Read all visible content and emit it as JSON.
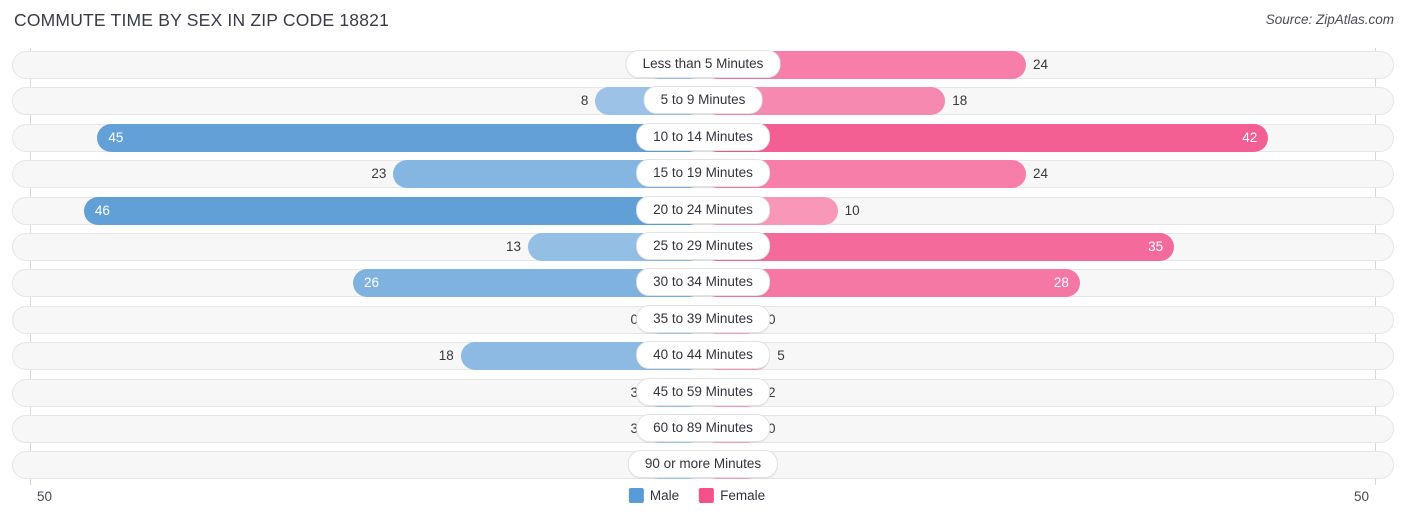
{
  "header": {
    "title": "COMMUTE TIME BY SEX IN ZIP CODE 18821",
    "source": "Source: ZipAtlas.com"
  },
  "axis": {
    "left_max_label": "50",
    "right_max_label": "50"
  },
  "legend": {
    "items": [
      {
        "label": "Male",
        "color": "#5b9bd5"
      },
      {
        "label": "Female",
        "color": "#f2518a"
      }
    ]
  },
  "colors": {
    "male_high": "#5b9bd5",
    "male_low": "#a8cbeb",
    "female_high": "#f2518a",
    "female_low": "#f9a8c4",
    "track_bg": "#f7f7f7",
    "track_border": "#e6e6e6",
    "gridline": "#d8d8d8"
  },
  "chart_data": {
    "type": "bar",
    "title": "COMMUTE TIME BY SEX IN ZIP CODE 18821",
    "subtitle": "Source: ZipAtlas.com",
    "orientation": "horizontal-diverging",
    "xlabel": "",
    "ylabel": "",
    "axis_max": 50,
    "xlim": [
      50,
      50
    ],
    "grid": true,
    "legend_position": "bottom-center",
    "categories": [
      "Less than 5 Minutes",
      "5 to 9 Minutes",
      "10 to 14 Minutes",
      "15 to 19 Minutes",
      "20 to 24 Minutes",
      "25 to 29 Minutes",
      "30 to 34 Minutes",
      "35 to 39 Minutes",
      "40 to 44 Minutes",
      "45 to 59 Minutes",
      "60 to 89 Minutes",
      "90 or more Minutes"
    ],
    "series": [
      {
        "name": "Male",
        "side": "left",
        "color": "#5b9bd5",
        "values": [
          4,
          8,
          45,
          23,
          46,
          13,
          26,
          0,
          18,
          3,
          3,
          0
        ]
      },
      {
        "name": "Female",
        "side": "right",
        "color": "#f2518a",
        "values": [
          24,
          18,
          42,
          24,
          10,
          35,
          28,
          0,
          5,
          2,
          0,
          0
        ]
      }
    ]
  }
}
